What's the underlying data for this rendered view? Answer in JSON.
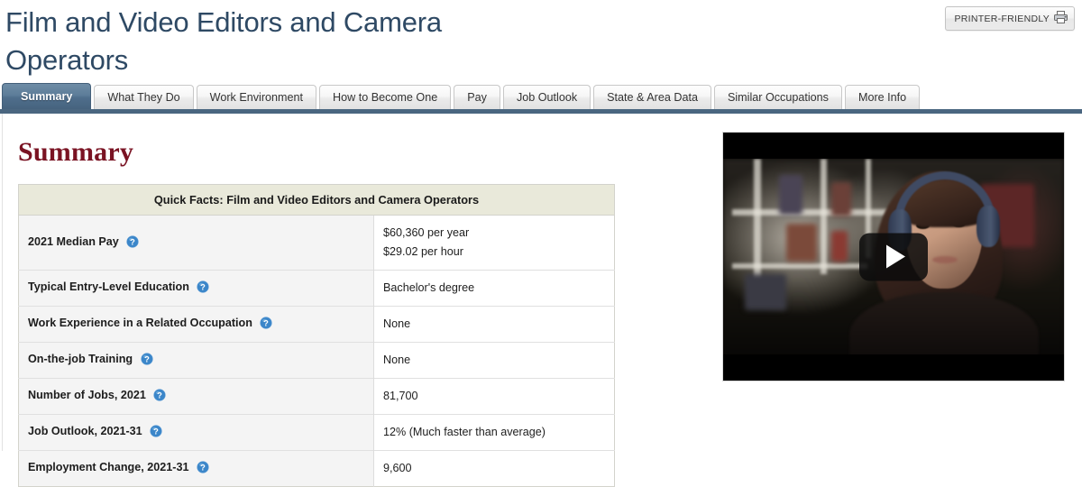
{
  "header": {
    "title": "Film and Video Editors and Camera Operators",
    "printer_friendly_label": "PRINTER-FRIENDLY",
    "printer_icon": "printer-icon",
    "title_color": "#2e4964"
  },
  "tabs": {
    "active_index": 0,
    "accent_color": "#4a6680",
    "items": [
      {
        "label": "Summary"
      },
      {
        "label": "What They Do"
      },
      {
        "label": "Work Environment"
      },
      {
        "label": "How to Become One"
      },
      {
        "label": "Pay"
      },
      {
        "label": "Job Outlook"
      },
      {
        "label": "State & Area Data"
      },
      {
        "label": "Similar Occupations"
      },
      {
        "label": "More Info"
      }
    ]
  },
  "main": {
    "section_heading": "Summary",
    "section_heading_color": "#7a1323",
    "table": {
      "caption": "Quick Facts: Film and Video Editors and Camera Operators",
      "help_icon": "help-question-icon",
      "rows": [
        {
          "label": "2021 Median Pay",
          "value_lines": [
            "$60,360 per year",
            "$29.02 per hour"
          ]
        },
        {
          "label": "Typical Entry-Level Education",
          "value_lines": [
            "Bachelor's degree"
          ]
        },
        {
          "label": "Work Experience in a Related Occupation",
          "value_lines": [
            "None"
          ]
        },
        {
          "label": "On-the-job Training",
          "value_lines": [
            "None"
          ]
        },
        {
          "label": "Number of Jobs, 2021",
          "value_lines": [
            "81,700"
          ]
        },
        {
          "label": "Job Outlook, 2021-31",
          "value_lines": [
            "12% (Much faster than average)"
          ]
        },
        {
          "label": "Employment Change, 2021-31",
          "value_lines": [
            "9,600"
          ]
        }
      ]
    }
  },
  "video": {
    "play_icon": "play-triangle-icon",
    "scene_description": "woman wearing headphones at a computer in a dim room"
  }
}
